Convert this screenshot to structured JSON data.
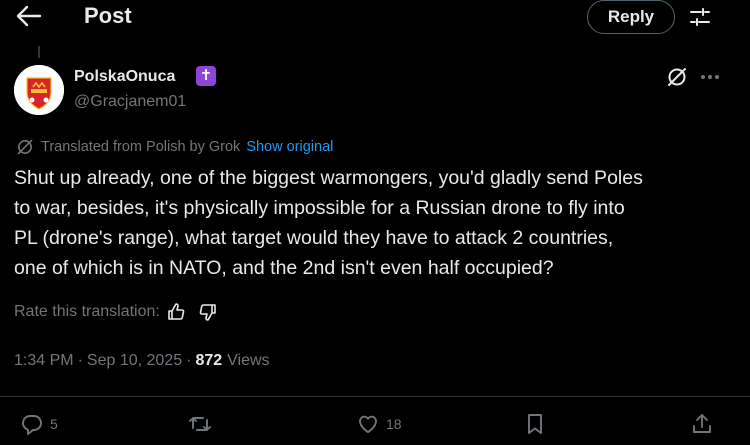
{
  "header": {
    "title": "Post",
    "reply_button": "Reply"
  },
  "author": {
    "display_name": "PolskaOnuca",
    "badge_glyph": "✝",
    "handle": "@Gracjanem01"
  },
  "translation": {
    "label": "Translated from Polish by Grok",
    "show_original": "Show original"
  },
  "tweet": {
    "text": "Shut up already, one of the biggest warmongers, you'd gladly send Poles\nto war, besides, it's physically impossible for a Russian drone to fly into\nPL (drone's range), what target would they have to attack 2 countries,\none of which is in NATO, and the 2nd isn't even half occupied?"
  },
  "rate": {
    "label": "Rate this translation:"
  },
  "meta": {
    "time": "1:34 PM",
    "sep": "·",
    "date": "Sep 10, 2025",
    "views": "872",
    "views_label": "Views"
  },
  "actions": {
    "replies": "5",
    "reposts": "",
    "likes": "18"
  },
  "colors": {
    "background": "#000000",
    "text": "#e7e9ea",
    "muted": "#71767b",
    "link": "#1d9bf0",
    "badge": "#8e44d6"
  },
  "icons": [
    "back-arrow-icon",
    "tune-icon",
    "grok-icon",
    "more-icon",
    "thumbs-up-icon",
    "thumbs-down-icon",
    "reply-icon",
    "repost-icon",
    "like-icon",
    "bookmark-icon",
    "share-icon"
  ]
}
